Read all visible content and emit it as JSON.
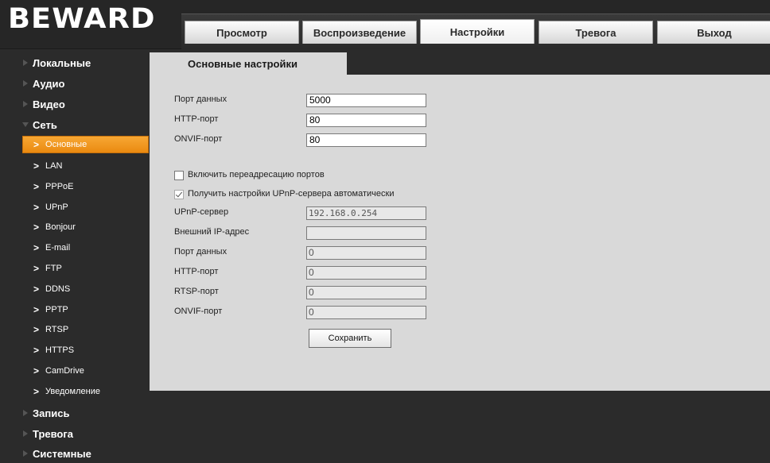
{
  "header": {
    "logo": "BEWARD",
    "tabs": [
      {
        "label": "Просмотр"
      },
      {
        "label": "Воспроизведение"
      },
      {
        "label": "Настройки",
        "active": true
      },
      {
        "label": "Тревога"
      },
      {
        "label": "Выход"
      }
    ]
  },
  "sidebar": {
    "sections": [
      {
        "label": "Локальные"
      },
      {
        "label": "Аудио"
      },
      {
        "label": "Видео"
      },
      {
        "label": "Сеть",
        "expanded": true
      },
      {
        "label": "Запись"
      },
      {
        "label": "Тревога"
      },
      {
        "label": "Системные"
      }
    ],
    "network_items": [
      {
        "label": "Основные",
        "active": true
      },
      {
        "label": "LAN"
      },
      {
        "label": "PPPoE"
      },
      {
        "label": "UPnP"
      },
      {
        "label": "Bonjour"
      },
      {
        "label": "E-mail"
      },
      {
        "label": "FTP"
      },
      {
        "label": "DDNS"
      },
      {
        "label": "PPTP"
      },
      {
        "label": "RTSP"
      },
      {
        "label": "HTTPS"
      },
      {
        "label": "CamDrive"
      },
      {
        "label": "Уведомление"
      }
    ]
  },
  "main": {
    "tab_title": "Основные настройки",
    "fields": [
      {
        "label": "Порт данных",
        "value": "5000"
      },
      {
        "label": "HTTP-порт",
        "value": "80"
      },
      {
        "label": "ONVIF-порт",
        "value": "80"
      }
    ],
    "port_forwarding": {
      "label": "Включить переадресацию портов",
      "checked": false
    },
    "upnp_auto": {
      "label": "Получить настройки UPnP-сервера автоматически",
      "checked": true
    },
    "upnp_fields": [
      {
        "label": "UPnP-сервер",
        "value": "192.168.0.254"
      },
      {
        "label": "Внешний IP-адрес",
        "value": ""
      },
      {
        "label": "Порт данных",
        "value": "0"
      },
      {
        "label": "HTTP-порт",
        "value": "0"
      },
      {
        "label": "RTSP-порт",
        "value": "0"
      },
      {
        "label": "ONVIF-порт",
        "value": "0"
      }
    ],
    "save_label": "Сохранить"
  },
  "colors": {
    "accent": "#F29A1F",
    "background": "#2B2B2B",
    "panel": "#D9D9D9"
  }
}
